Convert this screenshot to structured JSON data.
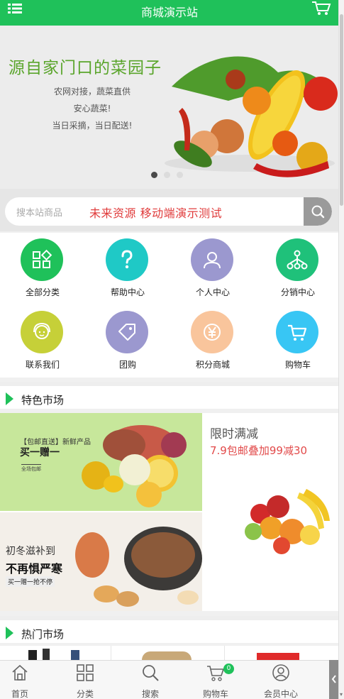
{
  "header": {
    "title": "商城演示站",
    "menu_icon": "list-menu-icon",
    "cart_icon": "shopping-cart-icon"
  },
  "banner": {
    "headline": "源自家门口的菜园子",
    "lines": [
      "农网对接，蔬菜直供",
      "安心蔬菜!",
      "当日采摘，当日配送!"
    ],
    "slide_count": 3,
    "active_slide": 1
  },
  "search": {
    "placeholder": "搜本站商品",
    "promo": "未来资源  移动端演示测试",
    "button_icon": "search-icon"
  },
  "nav": [
    {
      "label": "全部分类",
      "icon": "grid-shapes-icon",
      "color": "#1fc15a"
    },
    {
      "label": "帮助中心",
      "icon": "question-icon",
      "color": "#1fc9c6"
    },
    {
      "label": "个人中心",
      "icon": "user-icon",
      "color": "#9b98cf"
    },
    {
      "label": "分销中心",
      "icon": "network-icon",
      "color": "#1fc17a"
    },
    {
      "label": "联系我们",
      "icon": "service-agent-icon",
      "color": "#c6d038"
    },
    {
      "label": "团购",
      "icon": "tag-icon",
      "color": "#9b98cf"
    },
    {
      "label": "积分商城",
      "icon": "yen-icon",
      "color": "#f9c59c"
    },
    {
      "label": "购物车",
      "icon": "cart-icon",
      "color": "#38c6f4"
    }
  ],
  "sections": {
    "featured": "特色市场",
    "hot": "热门市场"
  },
  "market": {
    "promo1": {
      "tag": "【包邮直送】新鲜产品",
      "title": "买一赠一",
      "note": "全场包邮"
    },
    "promo2": {
      "line1": "初冬滋补到",
      "line2": "不再惧严寒",
      "note": "买一赠一抢不停"
    },
    "promo3": {
      "title": "限时满减",
      "subtitle": "7.9包邮叠加99减30"
    }
  },
  "tabbar": [
    {
      "label": "首页",
      "icon": "home-icon"
    },
    {
      "label": "分类",
      "icon": "category-icon"
    },
    {
      "label": "搜索",
      "icon": "search-icon"
    },
    {
      "label": "购物车",
      "icon": "cart-icon",
      "badge": "0"
    },
    {
      "label": "会员中心",
      "icon": "member-icon"
    }
  ],
  "colors": {
    "brand": "#1fc15a",
    "promo_red": "#e03b3b"
  }
}
